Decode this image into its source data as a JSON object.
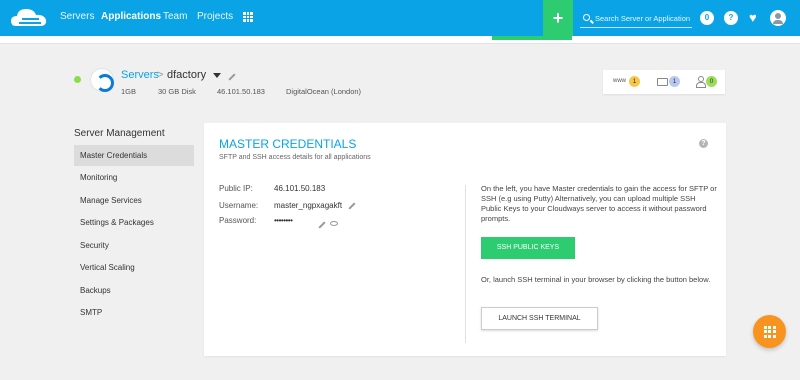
{
  "nav": {
    "links": [
      "Servers",
      "Applications",
      "Team",
      "Projects"
    ],
    "active": "Applications",
    "add_label": "+",
    "search_placeholder": "Search Server or Application",
    "notifications_count": "0",
    "help_label": "?"
  },
  "server": {
    "breadcrumb_root": "Servers",
    "breadcrumb_sep": ">",
    "name": "dfactory",
    "ram": "1GB",
    "disk": "30 GB Disk",
    "ip": "46.101.50.183",
    "provider": "DigitalOcean (London)"
  },
  "badges": {
    "www_label": "www",
    "www_count": "1",
    "folder_count": "1",
    "users_count": "0"
  },
  "sidebar": {
    "title": "Server Management",
    "items": [
      "Master Credentials",
      "Monitoring",
      "Manage Services",
      "Settings & Packages",
      "Security",
      "Vertical Scaling",
      "Backups",
      "SMTP"
    ]
  },
  "credentials": {
    "title": "MASTER CREDENTIALS",
    "subtitle": "SFTP and SSH access details for all applications",
    "public_ip_label": "Public IP:",
    "public_ip": "46.101.50.183",
    "username_label": "Username:",
    "username": "master_ngpxagakft",
    "password_label": "Password:",
    "password_mask": "••••••••",
    "info_1": "On the left, you have Master credentials to gain the access for SFTP or SSH (e.g using Putty) Alternatively, you can upload multiple SSH Public Keys to your Cloudways server to access it without password prompts.",
    "ssh_button": "SSH PUBLIC KEYS",
    "info_2": "Or, launch SSH terminal in your browser by clicking the button below.",
    "launch_button": "LAUNCH SSH TERMINAL"
  },
  "colors": {
    "primary": "#0aa3e6",
    "green": "#2ecc71",
    "orange": "#f7931e"
  }
}
